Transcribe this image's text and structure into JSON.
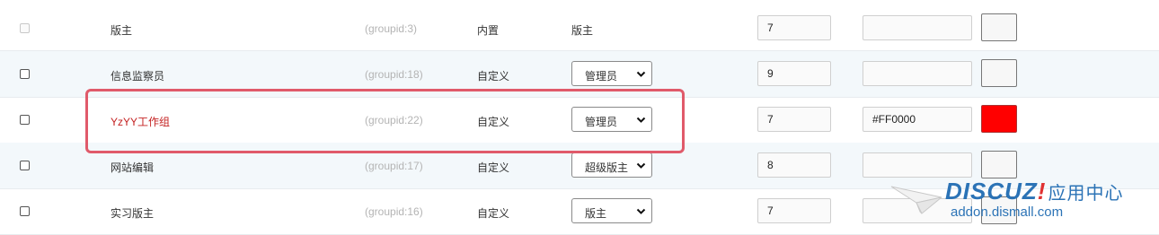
{
  "rows": [
    {
      "checkbox_disabled": true,
      "name": "版主",
      "groupid": "(groupid:3)",
      "type": "内置",
      "role": "版主",
      "role_is_select": false,
      "stars": "7",
      "color": "",
      "swatch_color": "#f7f7f7",
      "name_color": ""
    },
    {
      "checkbox_disabled": false,
      "name": "信息监察员",
      "groupid": "(groupid:18)",
      "type": "自定义",
      "role": "管理员",
      "role_is_select": true,
      "stars": "9",
      "color": "",
      "swatch_color": "#f7f7f7",
      "name_color": ""
    },
    {
      "checkbox_disabled": false,
      "name": "YzYY工作组",
      "groupid": "(groupid:22)",
      "type": "自定义",
      "role": "管理员",
      "role_is_select": true,
      "stars": "7",
      "color": "#FF0000",
      "swatch_color": "#FF0000",
      "name_color": "#c42222"
    },
    {
      "checkbox_disabled": false,
      "name": "网站编辑",
      "groupid": "(groupid:17)",
      "type": "自定义",
      "role": "超级版主",
      "role_is_select": true,
      "stars": "8",
      "color": "",
      "swatch_color": "#f7f7f7",
      "name_color": ""
    },
    {
      "checkbox_disabled": false,
      "name": "实习版主",
      "groupid": "(groupid:16)",
      "type": "自定义",
      "role": "版主",
      "role_is_select": true,
      "stars": "7",
      "color": "",
      "swatch_color": "#f7f7f7",
      "name_color": ""
    }
  ],
  "highlight_color": "#e05a6a",
  "watermark": {
    "brand": "DISCUZ",
    "bang": "!",
    "app_text": "应用中心",
    "url": "addon.dismall.com",
    "brand_color": "#2b73b6",
    "bang_color": "#e03030"
  }
}
